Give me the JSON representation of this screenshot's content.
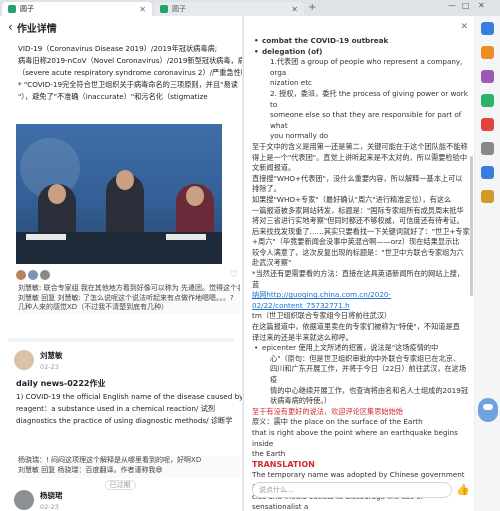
{
  "tabs": [
    {
      "label": "圆子",
      "active": true
    },
    {
      "label": "圆子",
      "active": false
    }
  ],
  "window": {
    "minimize": "—",
    "maximize": "□",
    "close": "✕",
    "newtab": "+"
  },
  "left": {
    "header_title": "作业详情",
    "article_lines": [
      "VID-19（Coronavirus Disease 2019）/2019年冠状病毒病;",
      "病毒旧称2019-nCoV（Novel Coronavirus）/2019新型冠状病毒，病毒新",
      "（severe acute respiratory syndrome coronavirus 2）/严重急性呼吸综合",
      "* \"COVID-19完全符合世卫组织关于病毒命名的三项原则，并且\"易读（p",
      "\"），避免了\"不准确（inaccurate）\"和污名化（stigmatize"
    ],
    "comment1": [
      "刘慧敏: 联合专家组 我在其他地方看到好像可以称为 先遣团。觉得这个名",
      "刘慧敏 回复 刘慧敏: 了怎么说呢这个说法听起来有点做作地嗯嗯。。。?",
      "几种人来的感觉XD（不过我不清楚到底有几种）"
    ],
    "user1": {
      "name": "刘慧敏",
      "date": "02-23"
    },
    "post1_title": "daily news-0222作业",
    "post1_lines": [
      "1) COVID-19 the official English name of the disease caused by the novel",
      "reagent：a substance used in a chemical reaction/ 试剂",
      "diagnostics the practice of using diagnostic methods/ 诊断学"
    ],
    "comment2": [
      "杨骁瑞：! 闷闷这项理这个解释是从哪里看到的呢，好啊XD",
      "刘慧敏 回复 杨骁瑞：百度翻译。作者谨称我😄"
    ],
    "separator": "已过期",
    "user2": {
      "name": "杨骁珺",
      "date": "02-23"
    }
  },
  "right": {
    "close": "✕",
    "lines": [
      {
        "t": "combat the COVID-19 outbreak",
        "c": "bul b"
      },
      {
        "t": "delegation (of)",
        "c": "bul b"
      },
      {
        "t": "1.代表团 a group of people who represent a company, orga",
        "c": "ind"
      },
      {
        "t": "nization etc",
        "c": "ind"
      },
      {
        "t": "2. 授权，委派，委托 the process of giving power or work to",
        "c": "ind"
      },
      {
        "t": "someone else so that they are responsible for part of what",
        "c": "ind"
      },
      {
        "t": "you normally do",
        "c": "ind"
      },
      {
        "t": "至于文中的含义是用第一还是第二，关键可能在于这个团队能不能称",
        "c": ""
      },
      {
        "t": "得上是一个\"代表团\"。直觉上讲听起来是不太对的，所以需要检验中",
        "c": ""
      },
      {
        "t": "文新闻报道。",
        "c": ""
      },
      {
        "t": "直接搜\"WHO+代表团\"，没什么重要内容，所以解释一基本上可以",
        "c": ""
      },
      {
        "t": "排除了。",
        "c": ""
      },
      {
        "t": "如果搜\"WHO+专家\"（最好确认\"周六\"进行精准定位），有这么",
        "c": ""
      },
      {
        "t": "一篇报道被多家网站转发，标题是：\"国际专家组所有成员周末抵华",
        "c": ""
      },
      {
        "t": " 将对三省进行实地考察\"但同时都还不够权威，可信度还有待考证。",
        "c": ""
      },
      {
        "t": "后来找找发现重了……其实只要看找一下关键词就好了：\"世卫+专家",
        "c": ""
      },
      {
        "t": "+周六\"（毕竟要新闻会没事中英混合啊——orz）现在结果显示比",
        "c": ""
      },
      {
        "t": "较令人满意了，这次反复出现的标题是：\"世卫中方联合专家组为六",
        "c": ""
      },
      {
        "t": "赴武汉考察\"",
        "c": ""
      },
      {
        "t": "*当然还有更需要看的方法：直接在这具英语新闻所在的网站上搜，蓝",
        "c": ""
      },
      {
        "t": "纳网http://guoqing.china.com.cn/2020-02/22/content_75732771.h",
        "c": "link"
      },
      {
        "t": "tm（世卫组织联合专家组今日将前往武汉）",
        "c": ""
      },
      {
        "t": "在这篇报道中，依据道里卖在的专家们被称为\"特使\"，不知道是直",
        "c": ""
      },
      {
        "t": "译过来的还是半来就这么称呼。",
        "c": ""
      },
      {
        "t": "epicenter 使用上文所述的招置，说法是\"这场疫情的中",
        "c": "bul"
      },
      {
        "t": "心\"（原句：但是世卫组织审批的中外联合专家组已在北京、",
        "c": "ind"
      },
      {
        "t": "四川和广东开展工作，并将于今日（22日）前往武汉，在这场疫",
        "c": "ind"
      },
      {
        "t": "情的中心继续开展工作，也查询将由名和名人士组成的2019冠",
        "c": "ind"
      },
      {
        "t": "状病毒病的特使。）",
        "c": "ind"
      },
      {
        "t": "至于有没有更好的说法，欢迎评论区集思始始始",
        "c": "red"
      },
      {
        "t": "原义：震中 the place on the surface of the Earth",
        "c": ""
      },
      {
        "t": "that is right above the point where an earthquake begins inside",
        "c": ""
      },
      {
        "t": "the Earth",
        "c": ""
      },
      {
        "t": "TRANSLATION",
        "c": "trans"
      },
      {
        "t": "The temporary name was adopted by Chinese government agen",
        "c": ""
      },
      {
        "t": "cies and media outlets to discourage the use of sensationalist a",
        "c": ""
      }
    ],
    "input_placeholder": "说点什么...",
    "send_icon": "👍"
  }
}
